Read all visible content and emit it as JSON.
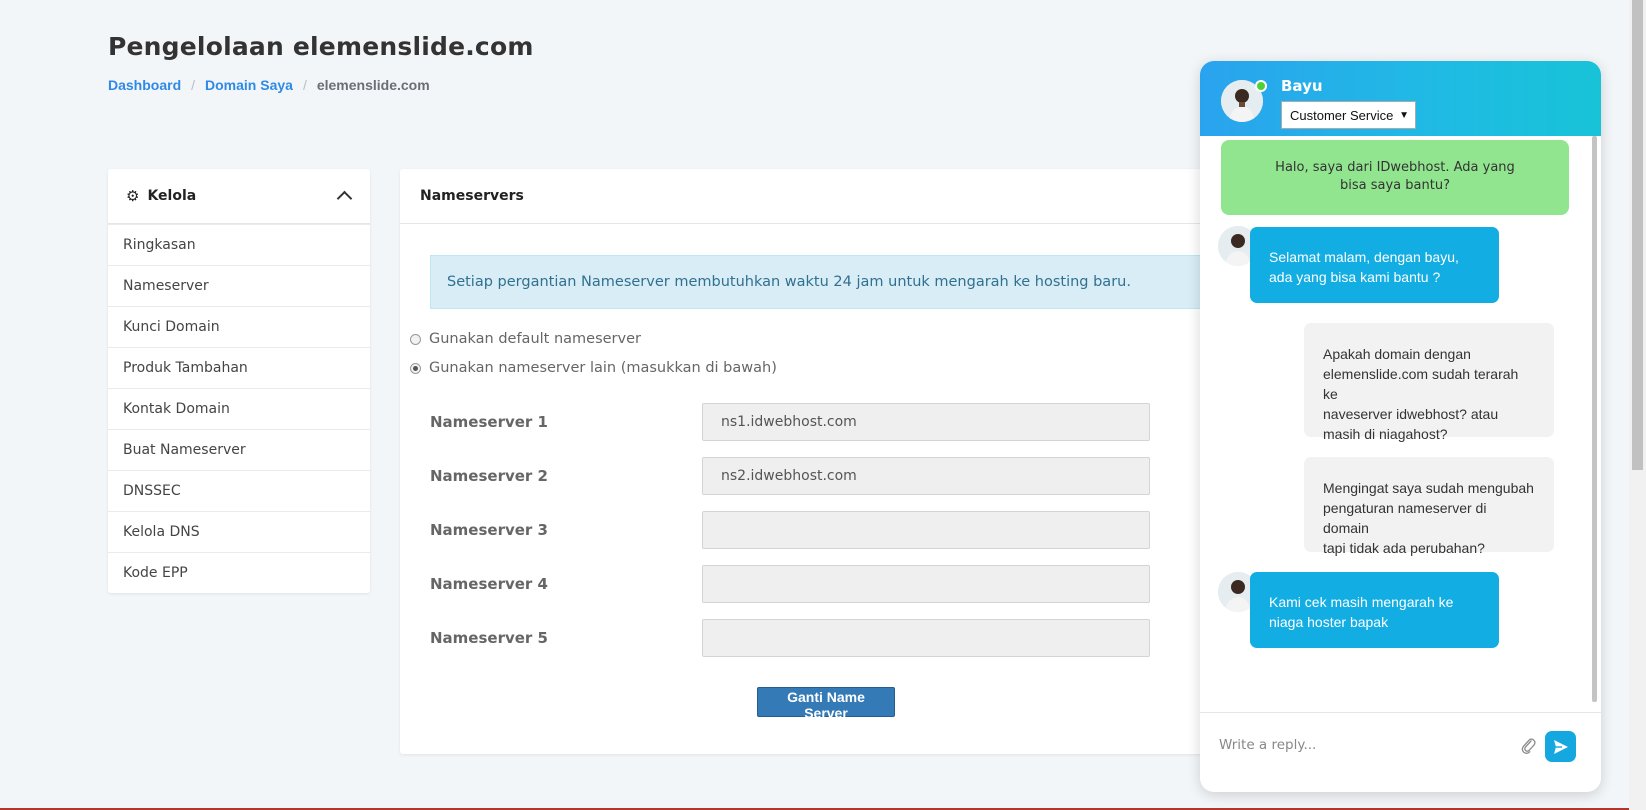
{
  "page": {
    "title": "Pengelolaan elemenslide.com",
    "breadcrumb": [
      "Dashboard",
      "Domain Saya",
      "elemenslide.com"
    ],
    "breadcrumb_separator": "/"
  },
  "sidebar": {
    "title": "Kelola",
    "items": [
      {
        "label": "Ringkasan"
      },
      {
        "label": "Nameserver"
      },
      {
        "label": "Kunci Domain"
      },
      {
        "label": "Produk Tambahan"
      },
      {
        "label": "Kontak Domain"
      },
      {
        "label": "Buat Nameserver"
      },
      {
        "label": "DNSSEC"
      },
      {
        "label": "Kelola DNS"
      },
      {
        "label": "Kode EPP"
      }
    ]
  },
  "nameservers": {
    "heading": "Nameservers",
    "info": "Setiap pergantian Nameserver membutuhkan waktu 24 jam untuk mengarah ke hosting baru.",
    "option_default": "Gunakan default nameserver",
    "option_custom": "Gunakan nameserver lain (masukkan di bawah)",
    "selected_option": "custom",
    "fields": [
      {
        "label": "Nameserver 1",
        "value": "ns1.idwebhost.com"
      },
      {
        "label": "Nameserver 2",
        "value": "ns2.idwebhost.com"
      },
      {
        "label": "Nameserver 3",
        "value": ""
      },
      {
        "label": "Nameserver 4",
        "value": ""
      },
      {
        "label": "Nameserver 5",
        "value": ""
      }
    ],
    "submit_label": "Ganti Name Server"
  },
  "chat": {
    "agent_name": "Bayu",
    "department": "Customer Service",
    "status": "online",
    "messages": [
      {
        "from": "system",
        "text": "Halo, saya dari IDwebhost. Ada yang bisa saya bantu?"
      },
      {
        "from": "agent",
        "lines": [
          "Selamat malam, dengan bayu,",
          "ada yang bisa kami bantu ?"
        ]
      },
      {
        "from": "user",
        "lines": [
          "Apakah domain dengan",
          "elemenslide.com sudah terarah ke",
          "naveserver idwebhost? atau",
          "masih di niagahost?"
        ]
      },
      {
        "from": "user",
        "lines": [
          "Mengingat saya sudah mengubah",
          "pengaturan nameserver di domain",
          "tapi tidak ada perubahan?"
        ]
      },
      {
        "from": "agent",
        "lines": [
          "Kami cek masih mengarah ke",
          "niaga hoster bapak"
        ]
      }
    ],
    "reply_placeholder": "Write a reply..."
  },
  "colors": {
    "link": "#2e8ae6",
    "primary_button": "#337ab7",
    "agent_bubble": "#11ade3",
    "system_bubble": "#92e58f",
    "header_gradient_start": "#2aa3ee",
    "header_gradient_end": "#18c3d7",
    "online": "#4cd137"
  },
  "icons": {
    "sidebar_header": "gear-icon",
    "sidebar_toggle": "chevron-up-icon",
    "attach": "paperclip-icon",
    "send": "send-icon"
  }
}
